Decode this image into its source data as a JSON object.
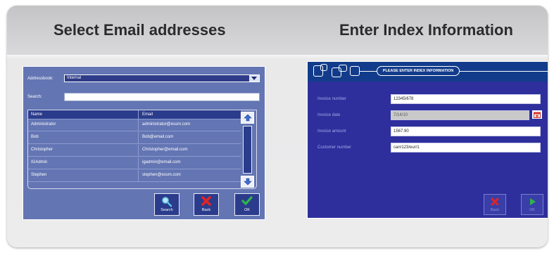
{
  "left_panel": {
    "heading": "Select Email addresses",
    "addressbook_label": "Addressbook:",
    "addressbook_value": "Internal",
    "search_label": "Search:",
    "search_value": "",
    "table": {
      "columns": [
        "Name",
        "Email"
      ],
      "rows": [
        [
          "Administrator",
          "administrator@essm.com"
        ],
        [
          "Bob",
          "Bob@email.com"
        ],
        [
          "Christopher",
          "Christopher@email.com"
        ],
        [
          "IGAdmin",
          "igadmin@email.com"
        ],
        [
          "Stephen",
          "stephen@essm.com"
        ]
      ]
    },
    "buttons": {
      "search": "Search",
      "back": "Back",
      "ok": "OK"
    }
  },
  "right_panel": {
    "heading": "Enter Index Information",
    "title_bar": "PLEASE ENTER INDEX INFORMATION",
    "fields": [
      {
        "label": "Invoice number",
        "value": "12345/678"
      },
      {
        "label": "Invoice date",
        "value": "7/14/10"
      },
      {
        "label": "Invoice amount",
        "value": "1567.90"
      },
      {
        "label": "Customer number",
        "value": "can/123/eur/1"
      }
    ],
    "buttons": {
      "back": "Back",
      "ok": "OK"
    }
  },
  "colors": {
    "card_bg": "#e9e9ea",
    "left_screen_bg": "#6375b3",
    "left_header_bg": "#2c3c8c",
    "right_screen_bg": "#2e2f9c",
    "cancel_red": "#e02424",
    "ok_green": "#2fb54a",
    "search_icon": "#5fc3e8"
  },
  "icons": {
    "search": "magnifier-icon",
    "back": "red-x-icon",
    "ok": "green-check-icon",
    "next": "green-triangle-icon",
    "calendar": "calendar-icon",
    "scroll_up": "arrow-up-icon",
    "scroll_down": "arrow-down-icon",
    "dropdown": "chevron-down-icon"
  }
}
